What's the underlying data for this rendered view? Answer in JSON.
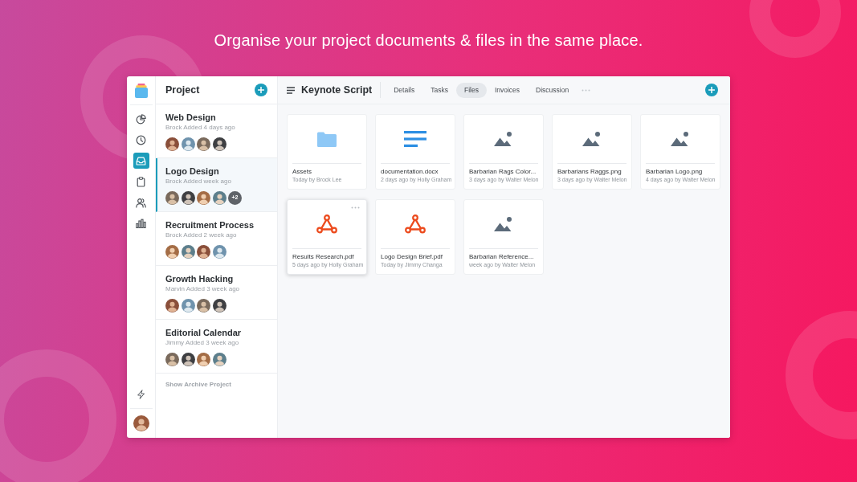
{
  "headline": "Organise your project documents & files in the same place.",
  "rail": {
    "nav": [
      {
        "selected": false
      },
      {
        "selected": false
      },
      {
        "selected": true
      },
      {
        "selected": false
      },
      {
        "selected": false
      },
      {
        "selected": false
      }
    ]
  },
  "projects": {
    "title": "Project",
    "items": [
      {
        "title": "Web Design",
        "subtitle": "Brock Added 4 days ago",
        "selected": false,
        "avatars": [
          {
            "kind": "photo"
          },
          {
            "kind": "photo"
          },
          {
            "kind": "photo"
          },
          {
            "kind": "photo"
          }
        ]
      },
      {
        "title": "Logo Design",
        "subtitle": "Brock Added week ago",
        "selected": true,
        "avatars": [
          {
            "kind": "photo"
          },
          {
            "kind": "photo"
          },
          {
            "kind": "photo"
          },
          {
            "kind": "photo"
          }
        ],
        "extra_members": "+2"
      },
      {
        "title": "Recruitment Process",
        "subtitle": "Brock Added 2 week ago",
        "selected": false,
        "avatars": [
          {
            "kind": "photo"
          },
          {
            "kind": "photo"
          },
          {
            "kind": "photo"
          },
          {
            "kind": "photo"
          }
        ]
      },
      {
        "title": "Growth Hacking",
        "subtitle": "Marvin Added 3 week ago",
        "selected": false,
        "avatars": [
          {
            "kind": "photo"
          },
          {
            "kind": "photo"
          },
          {
            "kind": "photo"
          },
          {
            "kind": "photo"
          }
        ]
      },
      {
        "title": "Editorial Calendar",
        "subtitle": "Jimmy Added 3 week ago",
        "selected": false,
        "avatars": [
          {
            "kind": "photo"
          },
          {
            "kind": "photo"
          },
          {
            "kind": "photo"
          },
          {
            "kind": "photo"
          }
        ]
      }
    ],
    "archive_link": "Show Archive Project"
  },
  "main": {
    "title": "Keynote Script",
    "tabs": [
      {
        "label": "Details",
        "selected": false
      },
      {
        "label": "Tasks",
        "selected": false
      },
      {
        "label": "Files",
        "selected": true
      },
      {
        "label": "Invoices",
        "selected": false
      },
      {
        "label": "Discussion",
        "selected": false
      }
    ],
    "files": [
      {
        "kind": "folder",
        "name": "Assets",
        "meta": "Today by Brock Lee",
        "hovered": false
      },
      {
        "kind": "document",
        "name": "documentation.docx",
        "meta": "2 days ago by Holly Graham",
        "hovered": false
      },
      {
        "kind": "image",
        "name": "Barbarian Rags Color...",
        "meta": "3 days ago by Walter Melon",
        "hovered": false
      },
      {
        "kind": "image",
        "name": "Barbarians Raggs.png",
        "meta": "3 days ago by Walter Melon",
        "hovered": false
      },
      {
        "kind": "image",
        "name": "Barbarian Logo.png",
        "meta": "4 days ago by Walter Melon",
        "hovered": false
      },
      {
        "kind": "pdf",
        "name": "Results Research.pdf",
        "meta": "5 days ago by Holly Graham",
        "hovered": true
      },
      {
        "kind": "pdf",
        "name": "Logo Design Brief.pdf",
        "meta": "Today by Jimmy Changa",
        "hovered": false
      },
      {
        "kind": "image",
        "name": "Barbarian Reference...",
        "meta": "week ago by Walter Melon",
        "hovered": false
      }
    ]
  }
}
